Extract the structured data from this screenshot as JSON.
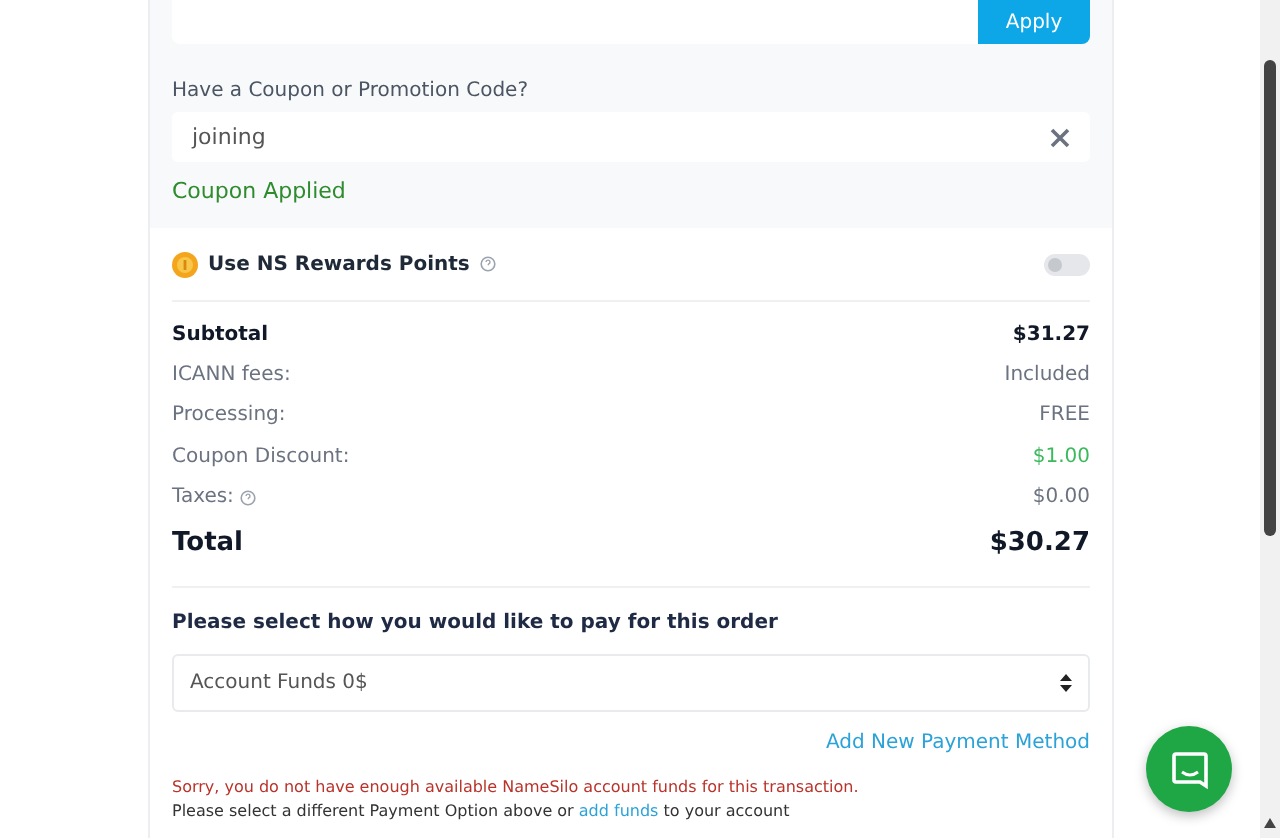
{
  "top_field": {
    "button": "Apply"
  },
  "coupon": {
    "label": "Have a Coupon or Promotion Code?",
    "value": "joining",
    "status": "Coupon Applied"
  },
  "rewards": {
    "label": "Use NS Rewards Points",
    "on": false
  },
  "summary": [
    {
      "label": "Subtotal",
      "value": "$31.27",
      "kind": "strong"
    },
    {
      "label": "ICANN fees:",
      "value": "Included",
      "kind": "plain"
    },
    {
      "label": "Processing:",
      "value": "FREE",
      "kind": "plain"
    },
    {
      "label": "Coupon Discount:",
      "value": "$1.00",
      "kind": "discount"
    },
    {
      "label": "Taxes:",
      "value": "$0.00",
      "kind": "help"
    },
    {
      "label": "Total",
      "value": "$30.27",
      "kind": "total"
    }
  ],
  "payment": {
    "heading": "Please select how you would like to pay for this order",
    "selected_option": "Account Funds 0$",
    "add_link": "Add New Payment Method",
    "error": "Sorry, you do not have enough available NameSilo account funds for this transaction.",
    "note_before": "Please select a different Payment Option above or",
    "note_link": "add funds",
    "note_after": "to your account"
  }
}
